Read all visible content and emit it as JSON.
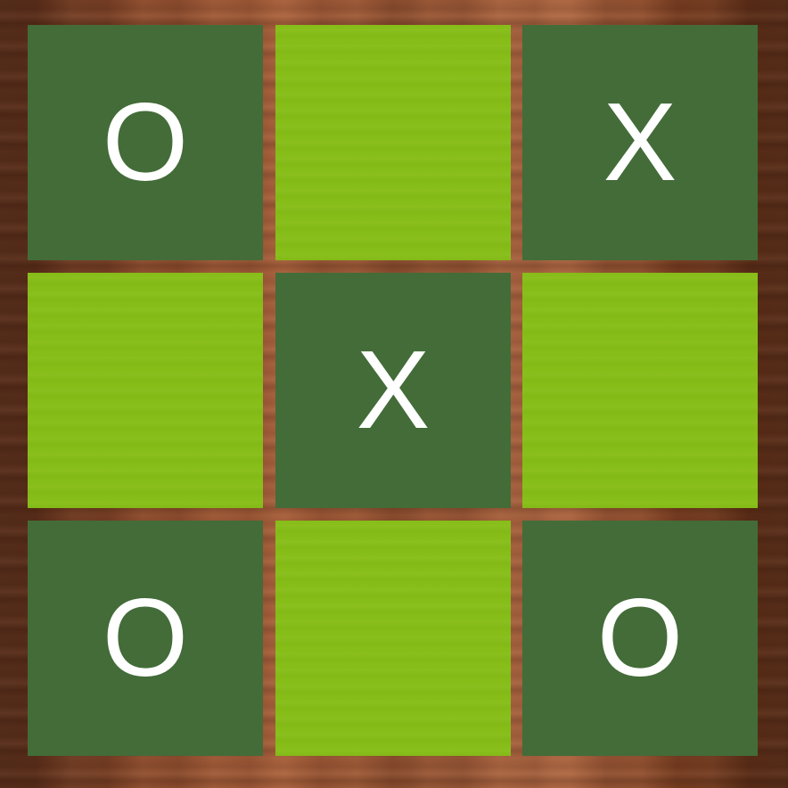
{
  "board": {
    "cells": [
      {
        "mark": "O",
        "shade": "dark"
      },
      {
        "mark": "",
        "shade": "light"
      },
      {
        "mark": "X",
        "shade": "dark"
      },
      {
        "mark": "",
        "shade": "light"
      },
      {
        "mark": "X",
        "shade": "dark"
      },
      {
        "mark": "",
        "shade": "light"
      },
      {
        "mark": "O",
        "shade": "dark"
      },
      {
        "mark": "",
        "shade": "light"
      },
      {
        "mark": "O",
        "shade": "dark"
      }
    ]
  },
  "colors": {
    "dark_cell": "#436c38",
    "light_cell": "#86bd17",
    "mark": "#ffffff",
    "background_wood": "#8a4a2c"
  }
}
